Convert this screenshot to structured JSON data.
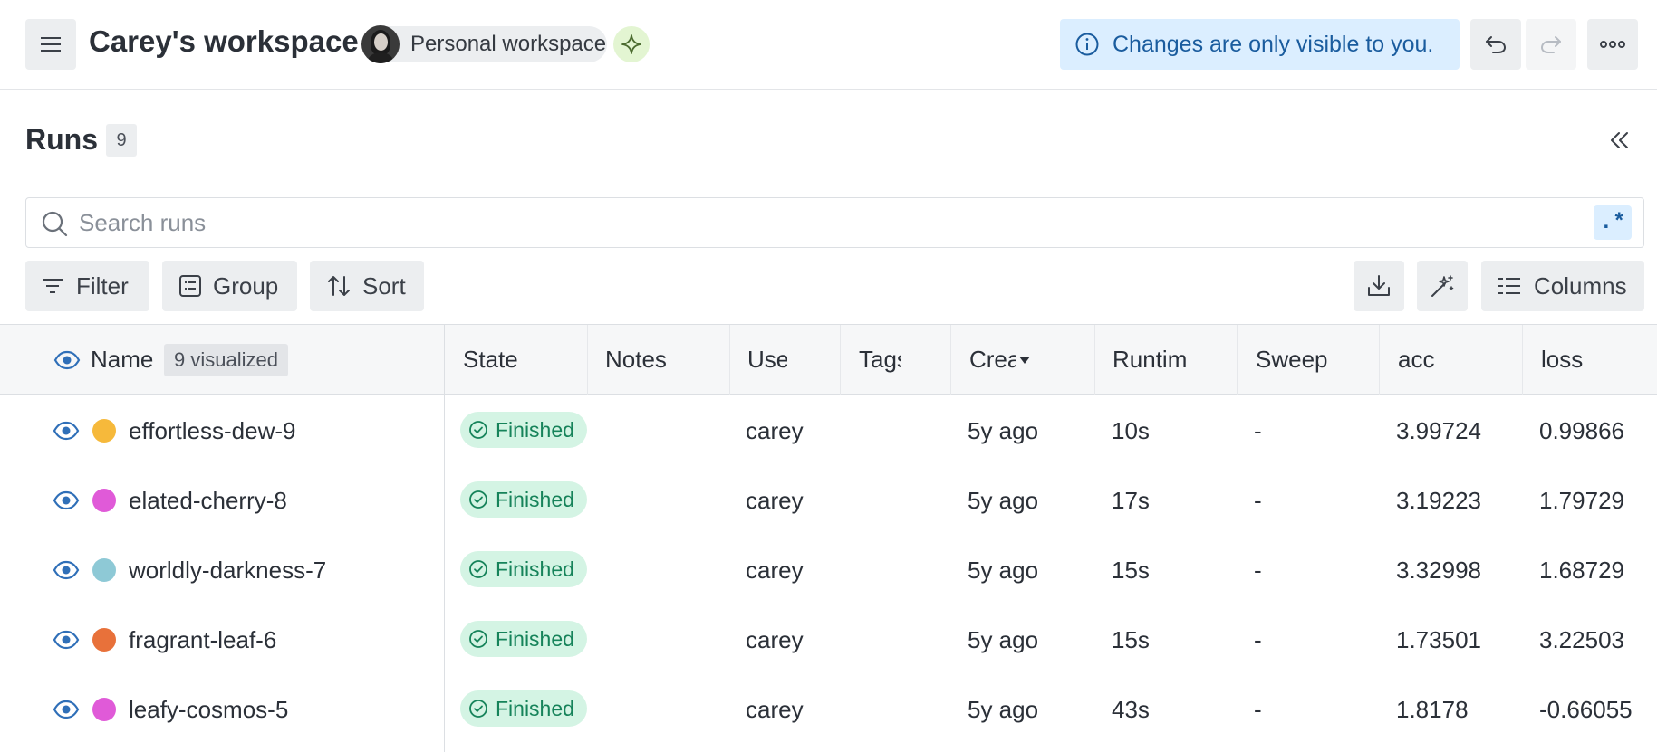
{
  "header": {
    "workspace_title": "Carey's workspace",
    "workspace_chip_label": "Personal workspace",
    "notice": "Changes are only visible to you."
  },
  "runs": {
    "title": "Runs",
    "count": "9"
  },
  "search": {
    "placeholder": "Search runs",
    "regex_label": ".*"
  },
  "toolbar": {
    "filter_label": "Filter",
    "group_label": "Group",
    "sort_label": "Sort",
    "columns_label": "Columns"
  },
  "table": {
    "name_header": "Name",
    "visualized_badge": "9 visualized",
    "columns": [
      "State",
      "Notes",
      "User",
      "Tags",
      "Created",
      "Runtime",
      "Sweep",
      "acc",
      "loss"
    ],
    "rows": [
      {
        "name": "effortless-dew-9",
        "color": "#f6b93b",
        "state": "Finished",
        "notes": "",
        "user": "carey",
        "tags": "",
        "created": "5y ago",
        "runtime": "10s",
        "sweep": "-",
        "acc": "3.99724",
        "loss": "0.99866"
      },
      {
        "name": "elated-cherry-8",
        "color": "#e05ad8",
        "state": "Finished",
        "notes": "",
        "user": "carey",
        "tags": "",
        "created": "5y ago",
        "runtime": "17s",
        "sweep": "-",
        "acc": "3.19223",
        "loss": "1.79729"
      },
      {
        "name": "worldly-darkness-7",
        "color": "#8ec9d6",
        "state": "Finished",
        "notes": "",
        "user": "carey",
        "tags": "",
        "created": "5y ago",
        "runtime": "15s",
        "sweep": "-",
        "acc": "3.32998",
        "loss": "1.68729"
      },
      {
        "name": "fragrant-leaf-6",
        "color": "#e8713a",
        "state": "Finished",
        "notes": "",
        "user": "carey",
        "tags": "",
        "created": "5y ago",
        "runtime": "15s",
        "sweep": "-",
        "acc": "1.73501",
        "loss": "3.22503"
      },
      {
        "name": "leafy-cosmos-5",
        "color": "#e05ad8",
        "state": "Finished",
        "notes": "",
        "user": "carey",
        "tags": "",
        "created": "5y ago",
        "runtime": "43s",
        "sweep": "-",
        "acc": "1.8178",
        "loss": "-0.66055"
      }
    ]
  },
  "colors": {
    "accent_blue": "#1a5c9e",
    "notice_bg": "#dbeeff",
    "finished_bg": "#d4f4e4",
    "finished_text": "#16835a"
  },
  "icons": [
    "hamburger-icon",
    "sparkle-icon",
    "info-icon",
    "undo-icon",
    "redo-icon",
    "more-icon",
    "collapse-left-icon",
    "search-icon",
    "filter-icon",
    "group-icon",
    "sort-icon",
    "download-icon",
    "magic-wand-icon",
    "columns-icon",
    "eye-icon",
    "check-circle-icon",
    "sort-desc-icon"
  ]
}
